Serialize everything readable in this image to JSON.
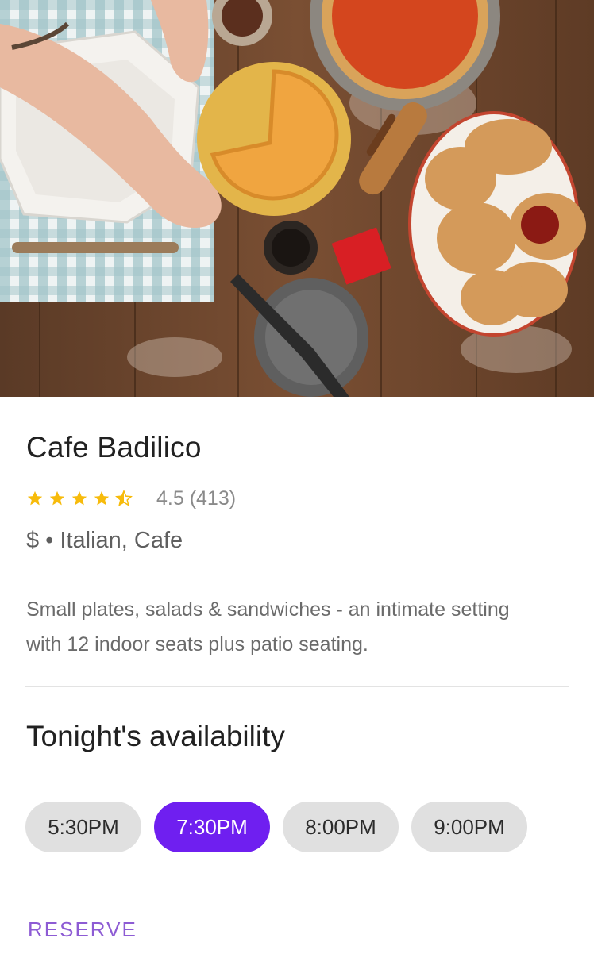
{
  "restaurant": {
    "name": "Cafe Badilico",
    "rating_text": "4.5 (413)",
    "rating": 4.5,
    "rating_max": 5,
    "meta": "$ • Italian, Cafe",
    "description": "Small plates, salads & sandwiches - an intimate setting with 12 indoor seats plus patio seating."
  },
  "availability": {
    "heading": "Tonight's availability",
    "slots": [
      "5:30PM",
      "7:30PM",
      "8:00PM",
      "9:00PM"
    ],
    "selected_index": 1
  },
  "actions": {
    "reserve_label": "RESERVE"
  },
  "colors": {
    "accent": "#6f1ff0",
    "reserve_text": "#8d5bd4",
    "star": "#f7bb0b",
    "chip_bg": "#e0e0e0"
  },
  "icons": {
    "star_full": "star-icon",
    "star_half": "star-half-icon"
  }
}
